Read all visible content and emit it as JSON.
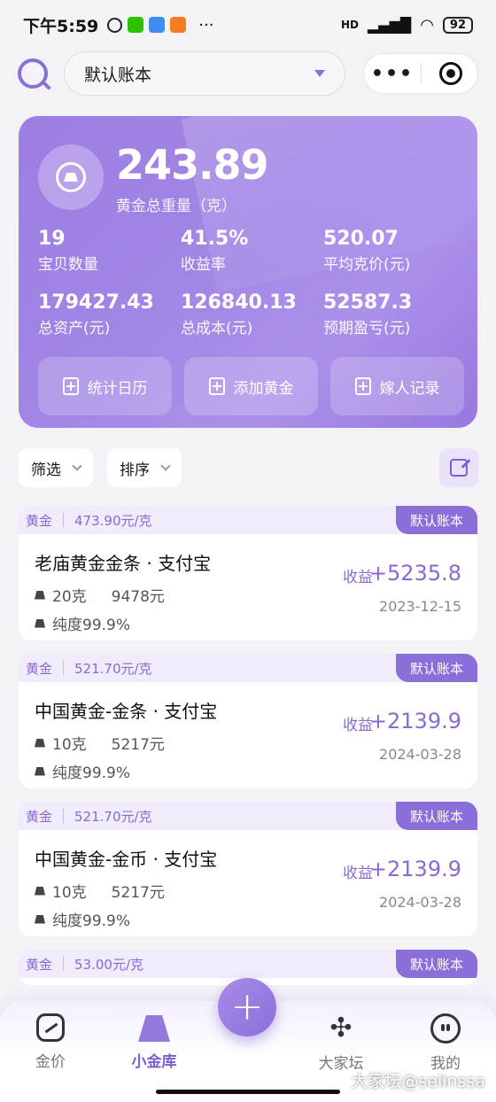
{
  "status_bar": {
    "time": "下午5:59",
    "network": "HD",
    "battery": "92"
  },
  "header": {
    "account_name": "默认账本",
    "more_label": "•••"
  },
  "summary": {
    "total_weight": "243.89",
    "total_weight_label": "黄金总重量（克）",
    "stats": [
      {
        "value": "19",
        "label": "宝贝数量"
      },
      {
        "value": "41.5%",
        "label": "收益率"
      },
      {
        "value": "520.07",
        "label": "平均克价(元)"
      },
      {
        "value": "179427.43",
        "label": "总资产(元)"
      },
      {
        "value": "126840.13",
        "label": "总成本(元)"
      },
      {
        "value": "52587.3",
        "label": "预期盈亏(元)"
      }
    ],
    "buttons": [
      "统计日历",
      "添加黄金",
      "嫁人记录"
    ]
  },
  "filters": {
    "filter_label": "筛选",
    "sort_label": "排序"
  },
  "items": [
    {
      "type": "黄金",
      "unit_price": "473.90元/克",
      "tag": "默认账本",
      "name": "老庙黄金金条 · 支付宝",
      "weight": "20克",
      "cost": "9478元",
      "purity": "纯度99.9%",
      "profit_label": "收益",
      "profit": "+5235.8",
      "date": "2023-12-15"
    },
    {
      "type": "黄金",
      "unit_price": "521.70元/克",
      "tag": "默认账本",
      "name": "中国黄金-金条 · 支付宝",
      "weight": "10克",
      "cost": "5217元",
      "purity": "纯度99.9%",
      "profit_label": "收益",
      "profit": "+2139.9",
      "date": "2024-03-28"
    },
    {
      "type": "黄金",
      "unit_price": "521.70元/克",
      "tag": "默认账本",
      "name": "中国黄金-金币 · 支付宝",
      "weight": "10克",
      "cost": "5217元",
      "purity": "纯度99.9%",
      "profit_label": "收益",
      "profit": "+2139.9",
      "date": "2024-03-28"
    },
    {
      "type": "黄金",
      "unit_price": "53.00元/克",
      "tag": "默认账本"
    }
  ],
  "nav": {
    "items": [
      "金价",
      "小金库",
      "大家坛",
      "我的"
    ],
    "fab": "+"
  },
  "watermark": "大家坛@selinssa",
  "colors": {
    "accent": "#8b6fd9",
    "card_gradient_start": "#9d7de2",
    "card_gradient_end": "#ab90ea",
    "background": "#f3f2f7"
  }
}
